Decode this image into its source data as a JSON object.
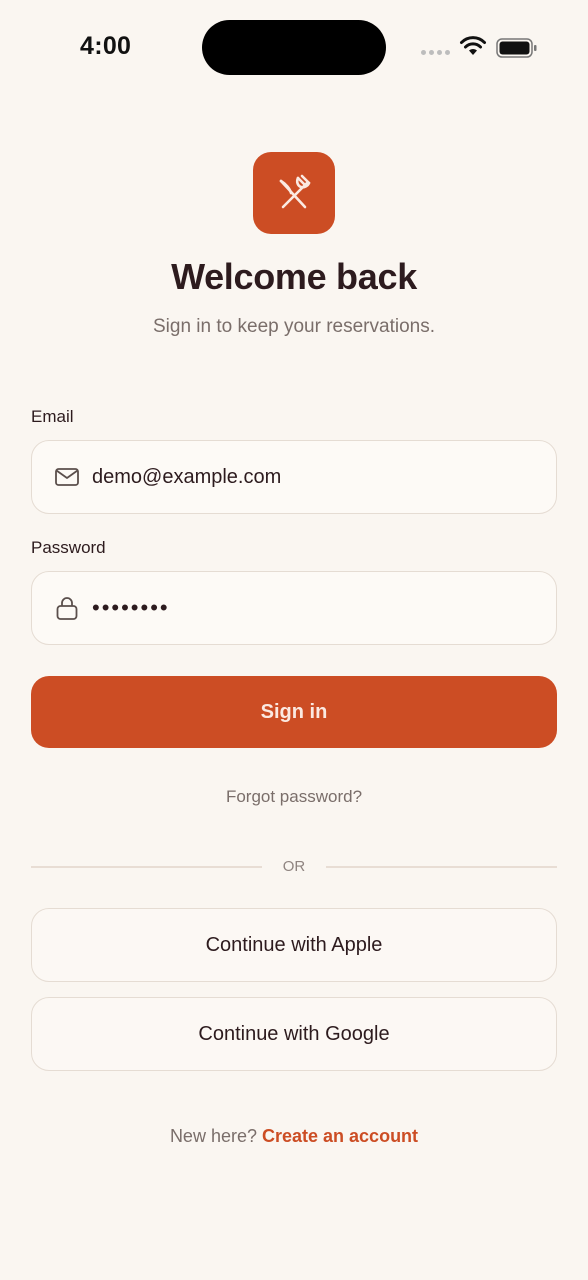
{
  "status_bar": {
    "time": "4:00",
    "icons": [
      "cellular-signal-icon",
      "wifi-icon",
      "battery-icon"
    ]
  },
  "brand": {
    "logo_icon": "fork-knife-icon",
    "accent_color": "#cc4d24"
  },
  "header": {
    "title": "Welcome back",
    "subtitle": "Sign in to keep your reservations."
  },
  "form": {
    "email": {
      "label": "Email",
      "value": "demo@example.com",
      "icon": "mail-icon"
    },
    "password": {
      "label": "Password",
      "value": "••••••••",
      "icon": "lock-icon"
    },
    "submit_label": "Sign in",
    "forgot_label": "Forgot password?"
  },
  "divider": {
    "text": "OR"
  },
  "social": {
    "apple_label": "Continue with Apple",
    "google_label": "Continue with Google"
  },
  "footer": {
    "prompt": "New here?",
    "link_label": "Create an account"
  }
}
